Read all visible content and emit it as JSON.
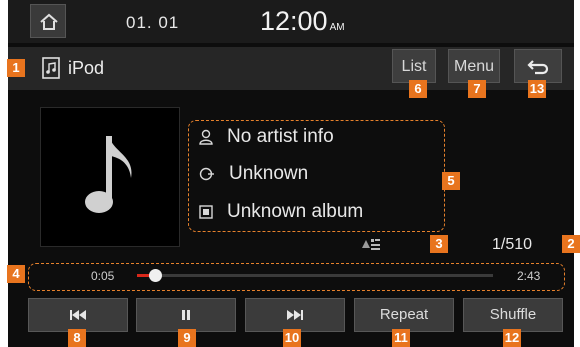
{
  "topbar": {
    "date": "01. 01",
    "time": "12:00",
    "ampm": "AM"
  },
  "source": {
    "label": "iPod",
    "icon": "music-file-icon"
  },
  "title_buttons": {
    "list": "List",
    "menu": "Menu",
    "back_icon": "back-arrow-icon"
  },
  "track_info": {
    "artist": "No artist info",
    "title": "Unknown",
    "album": "Unknown album"
  },
  "track_count": "1/510",
  "progress": {
    "elapsed": "0:05",
    "duration": "2:43",
    "fraction": 0.05
  },
  "controls": {
    "prev_icon": "skip-previous-icon",
    "pause_icon": "pause-icon",
    "next_icon": "skip-next-icon",
    "repeat": "Repeat",
    "shuffle": "Shuffle"
  },
  "callouts": [
    "1",
    "2",
    "3",
    "4",
    "5",
    "6",
    "7",
    "8",
    "9",
    "10",
    "11",
    "12",
    "13"
  ],
  "colors": {
    "accent": "#e8741e",
    "progress_fill": "#d9281a"
  }
}
